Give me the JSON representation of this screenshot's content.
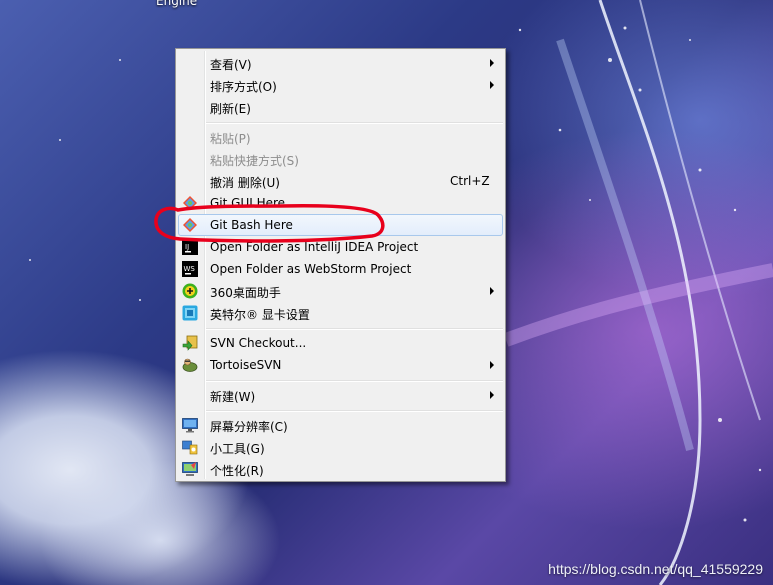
{
  "desktop": {
    "icon_label": "Engine",
    "watermark": "https://blog.csdn.net/qq_41559229"
  },
  "menu": {
    "items": [
      {
        "label": "查看(V)",
        "submenu": true
      },
      {
        "label": "排序方式(O)",
        "submenu": true
      },
      {
        "label": "刷新(E)"
      },
      {
        "label": "粘贴(P)",
        "disabled": true
      },
      {
        "label": "粘贴快捷方式(S)",
        "disabled": true
      },
      {
        "label": "撤消 删除(U)",
        "shortcut": "Ctrl+Z"
      },
      {
        "label": "Git GUI Here",
        "icon": "git-gui-icon"
      },
      {
        "label": "Git Bash Here",
        "icon": "git-bash-icon",
        "highlighted": true
      },
      {
        "label": "Open Folder as IntelliJ IDEA Project",
        "icon": "intellij-icon"
      },
      {
        "label": "Open Folder as WebStorm Project",
        "icon": "webstorm-icon"
      },
      {
        "label": "360桌面助手",
        "icon": "360-icon",
        "submenu": true
      },
      {
        "label": "英特尔® 显卡设置",
        "icon": "intel-graphics-icon"
      },
      {
        "label": "SVN Checkout...",
        "icon": "svn-checkout-icon"
      },
      {
        "label": "TortoiseSVN",
        "icon": "tortoisesvn-icon",
        "submenu": true
      },
      {
        "label": "新建(W)",
        "submenu": true
      },
      {
        "label": "屏幕分辨率(C)",
        "icon": "screen-resolution-icon"
      },
      {
        "label": "小工具(G)",
        "icon": "gadgets-icon"
      },
      {
        "label": "个性化(R)",
        "icon": "personalize-icon"
      }
    ],
    "icon_texts": {
      "intellij": "IJ",
      "webstorm": "WS"
    }
  },
  "colors": {
    "menu_bg": "#f0f0f0",
    "highlight_border": "#a8c8ec",
    "annotation_red": "#e8001c"
  }
}
